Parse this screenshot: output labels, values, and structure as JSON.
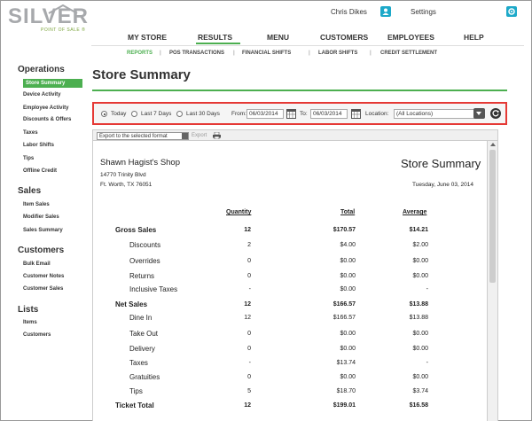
{
  "brand": {
    "logo_text": "SILVER",
    "logo_sub": "POINT OF SALE ®"
  },
  "userbar": {
    "user_name": "Chris Dikes",
    "settings_label": "Settings"
  },
  "main_nav": [
    "MY STORE",
    "RESULTS",
    "MENU",
    "CUSTOMERS",
    "EMPLOYEES",
    "HELP"
  ],
  "active_main_nav": "RESULTS",
  "sub_nav": [
    "REPORTS",
    "POS TRANSACTIONS",
    "FINANCIAL SHIFTS",
    "LABOR SHIFTS",
    "CREDIT SETTLEMENT"
  ],
  "active_sub_nav": "REPORTS",
  "sidebar": {
    "operations_heading": "Operations",
    "operations": [
      "Store Summary",
      "Device Activity",
      "Employee Activity",
      "Discounts & Offers",
      "Taxes",
      "Labor Shifts",
      "Tips",
      "Offline Credit"
    ],
    "sales_heading": "Sales",
    "sales": [
      "Item Sales",
      "Modifier Sales",
      "Sales Summary"
    ],
    "customers_heading": "Customers",
    "customers": [
      "Bulk Email",
      "Customer Notes",
      "Customer Sales"
    ],
    "lists_heading": "Lists",
    "lists": [
      "Items",
      "Customers"
    ]
  },
  "page_title": "Store Summary",
  "filters": {
    "today_label": "Today",
    "last7_label": "Last 7 Days",
    "last30_label": "Last 30 Days",
    "selected_range": "Today",
    "from_label": "From:",
    "from_value": "06/03/2014",
    "to_label": "To:",
    "to_value": "06/03/2014",
    "location_label": "Location:",
    "location_value": "(All Locations)"
  },
  "report_toolbar": {
    "export_select": "Export to the selected format",
    "export_link": "Export"
  },
  "report": {
    "shop_name": "Shawn Hagist's Shop",
    "address_line1": "14770 Trinity Blvd",
    "address_line2": "Ft. Worth, TX 76051",
    "title": "Store Summary",
    "date": "Tuesday, June 03, 2014",
    "columns": [
      "Quantity",
      "Total",
      "Average"
    ],
    "rows": [
      {
        "label": "Gross Sales",
        "qty": "12",
        "total": "$170.57",
        "avg": "$14.21",
        "bold": true,
        "indent": false
      },
      {
        "label": "Discounts",
        "qty": "2",
        "total": "$4.00",
        "avg": "$2.00",
        "bold": false,
        "indent": true
      },
      {
        "label": "Overrides",
        "qty": "0",
        "total": "$0.00",
        "avg": "$0.00",
        "bold": false,
        "indent": true
      },
      {
        "label": "Returns",
        "qty": "0",
        "total": "$0.00",
        "avg": "$0.00",
        "bold": false,
        "indent": true
      },
      {
        "label": "Inclusive Taxes",
        "qty": "-",
        "total": "$0.00",
        "avg": "-",
        "bold": false,
        "indent": true
      },
      {
        "label": "Net Sales",
        "qty": "12",
        "total": "$166.57",
        "avg": "$13.88",
        "bold": true,
        "indent": false
      },
      {
        "label": "Dine In",
        "qty": "12",
        "total": "$166.57",
        "avg": "$13.88",
        "bold": false,
        "indent": true
      },
      {
        "label": "Take Out",
        "qty": "0",
        "total": "$0.00",
        "avg": "$0.00",
        "bold": false,
        "indent": true
      },
      {
        "label": "Delivery",
        "qty": "0",
        "total": "$0.00",
        "avg": "$0.00",
        "bold": false,
        "indent": true
      },
      {
        "label": "Taxes",
        "qty": "-",
        "total": "$13.74",
        "avg": "-",
        "bold": false,
        "indent": true
      },
      {
        "label": "Gratuities",
        "qty": "0",
        "total": "$0.00",
        "avg": "$0.00",
        "bold": false,
        "indent": true
      },
      {
        "label": "Tips",
        "qty": "5",
        "total": "$18.70",
        "avg": "$3.74",
        "bold": false,
        "indent": true
      },
      {
        "label": "Ticket Total",
        "qty": "12",
        "total": "$199.01",
        "avg": "$16.58",
        "bold": true,
        "indent": false
      }
    ]
  },
  "colors": {
    "accent": "#4caf50",
    "highlight_border": "#e53935",
    "icon_blue": "#1da9c9"
  }
}
